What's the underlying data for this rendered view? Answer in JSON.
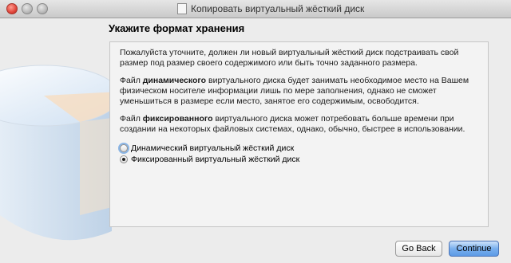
{
  "window": {
    "title": "Копировать виртуальный жёсткий диск"
  },
  "page": {
    "heading": "Укажите формат хранения",
    "intro": "Пожалуйста уточните, должен ли новый виртуальный жёсткий диск подстраивать свой размер под размер своего содержимого или быть точно заданного размера.",
    "dynamic_text": {
      "prefix": "Файл ",
      "bold": "динамического",
      "suffix": " виртуального диска будет занимать необходимое место на Вашем физическом носителе информации лишь по мере заполнения, однако не сможет уменьшиться в размере если место, занятое его содержимым, освободится."
    },
    "fixed_text": {
      "prefix": "Файл ",
      "bold": "фиксированного",
      "suffix": " виртуального диска может потребовать больше времени при создании на некоторых файловых системах, однако, обычно, быстрее в использовании."
    },
    "options": [
      {
        "label": "Динамический виртуальный жёсткий диск",
        "selected": false
      },
      {
        "label": "Фиксированный виртуальный жёсткий диск",
        "selected": true
      }
    ]
  },
  "buttons": {
    "back": "Go Back",
    "continue": "Continue"
  }
}
